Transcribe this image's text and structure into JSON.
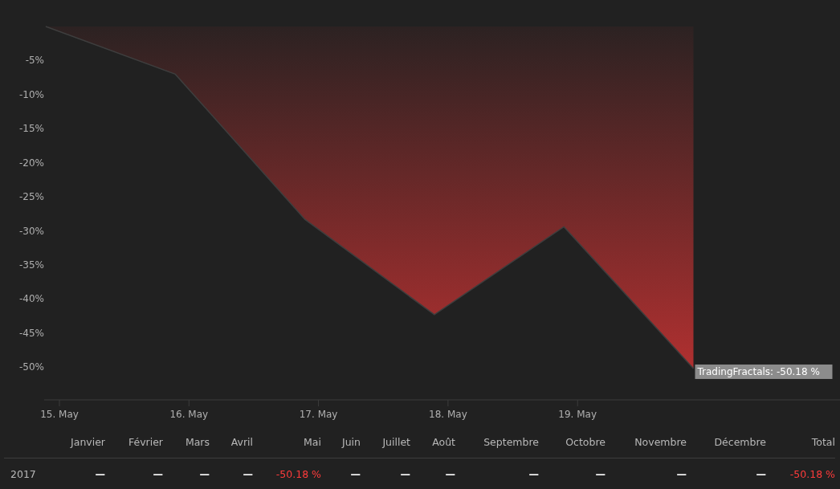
{
  "chart_data": {
    "type": "area",
    "ylim": [
      -54.8,
      0
    ],
    "categories": [
      "15. May",
      "16. May",
      "17. May",
      "18. May",
      "19. May",
      null
    ],
    "yticks": [
      {
        "value": -5,
        "label": "-5%"
      },
      {
        "value": -10,
        "label": "-10%"
      },
      {
        "value": -15,
        "label": "-15%"
      },
      {
        "value": -20,
        "label": "-20%"
      },
      {
        "value": -25,
        "label": "-25%"
      },
      {
        "value": -30,
        "label": "-30%"
      },
      {
        "value": -35,
        "label": "-35%"
      },
      {
        "value": -40,
        "label": "-40%"
      },
      {
        "value": -45,
        "label": "-45%"
      },
      {
        "value": -50,
        "label": "-50%"
      }
    ],
    "series": [
      {
        "color": "#b03030",
        "values": [
          0,
          -7,
          -28.3,
          -42.3,
          -29.4,
          -50.2
        ]
      }
    ],
    "annotations": [
      {
        "text": "TradingFractals: -50.18 %"
      }
    ]
  },
  "table": {
    "columns": [
      "Janvier",
      "Février",
      "Mars",
      "Avril",
      "Mai",
      "Juin",
      "Juillet",
      "Août",
      "Septembre",
      "Octobre",
      "Novembre",
      "Décembre",
      "Total"
    ],
    "rows": [
      {
        "label": "2017",
        "cells": [
          {
            "text": "—",
            "kind": "empty"
          },
          {
            "text": "—",
            "kind": "empty"
          },
          {
            "text": "—",
            "kind": "empty"
          },
          {
            "text": "—",
            "kind": "empty"
          },
          {
            "text": "-50.18 %",
            "kind": "loss"
          },
          {
            "text": "—",
            "kind": "empty"
          },
          {
            "text": "—",
            "kind": "empty"
          },
          {
            "text": "—",
            "kind": "empty"
          },
          {
            "text": "—",
            "kind": "empty"
          },
          {
            "text": "—",
            "kind": "empty"
          },
          {
            "text": "—",
            "kind": "empty"
          },
          {
            "text": "—",
            "kind": "empty"
          },
          {
            "text": "-50.18 %",
            "kind": "loss"
          }
        ]
      }
    ]
  }
}
